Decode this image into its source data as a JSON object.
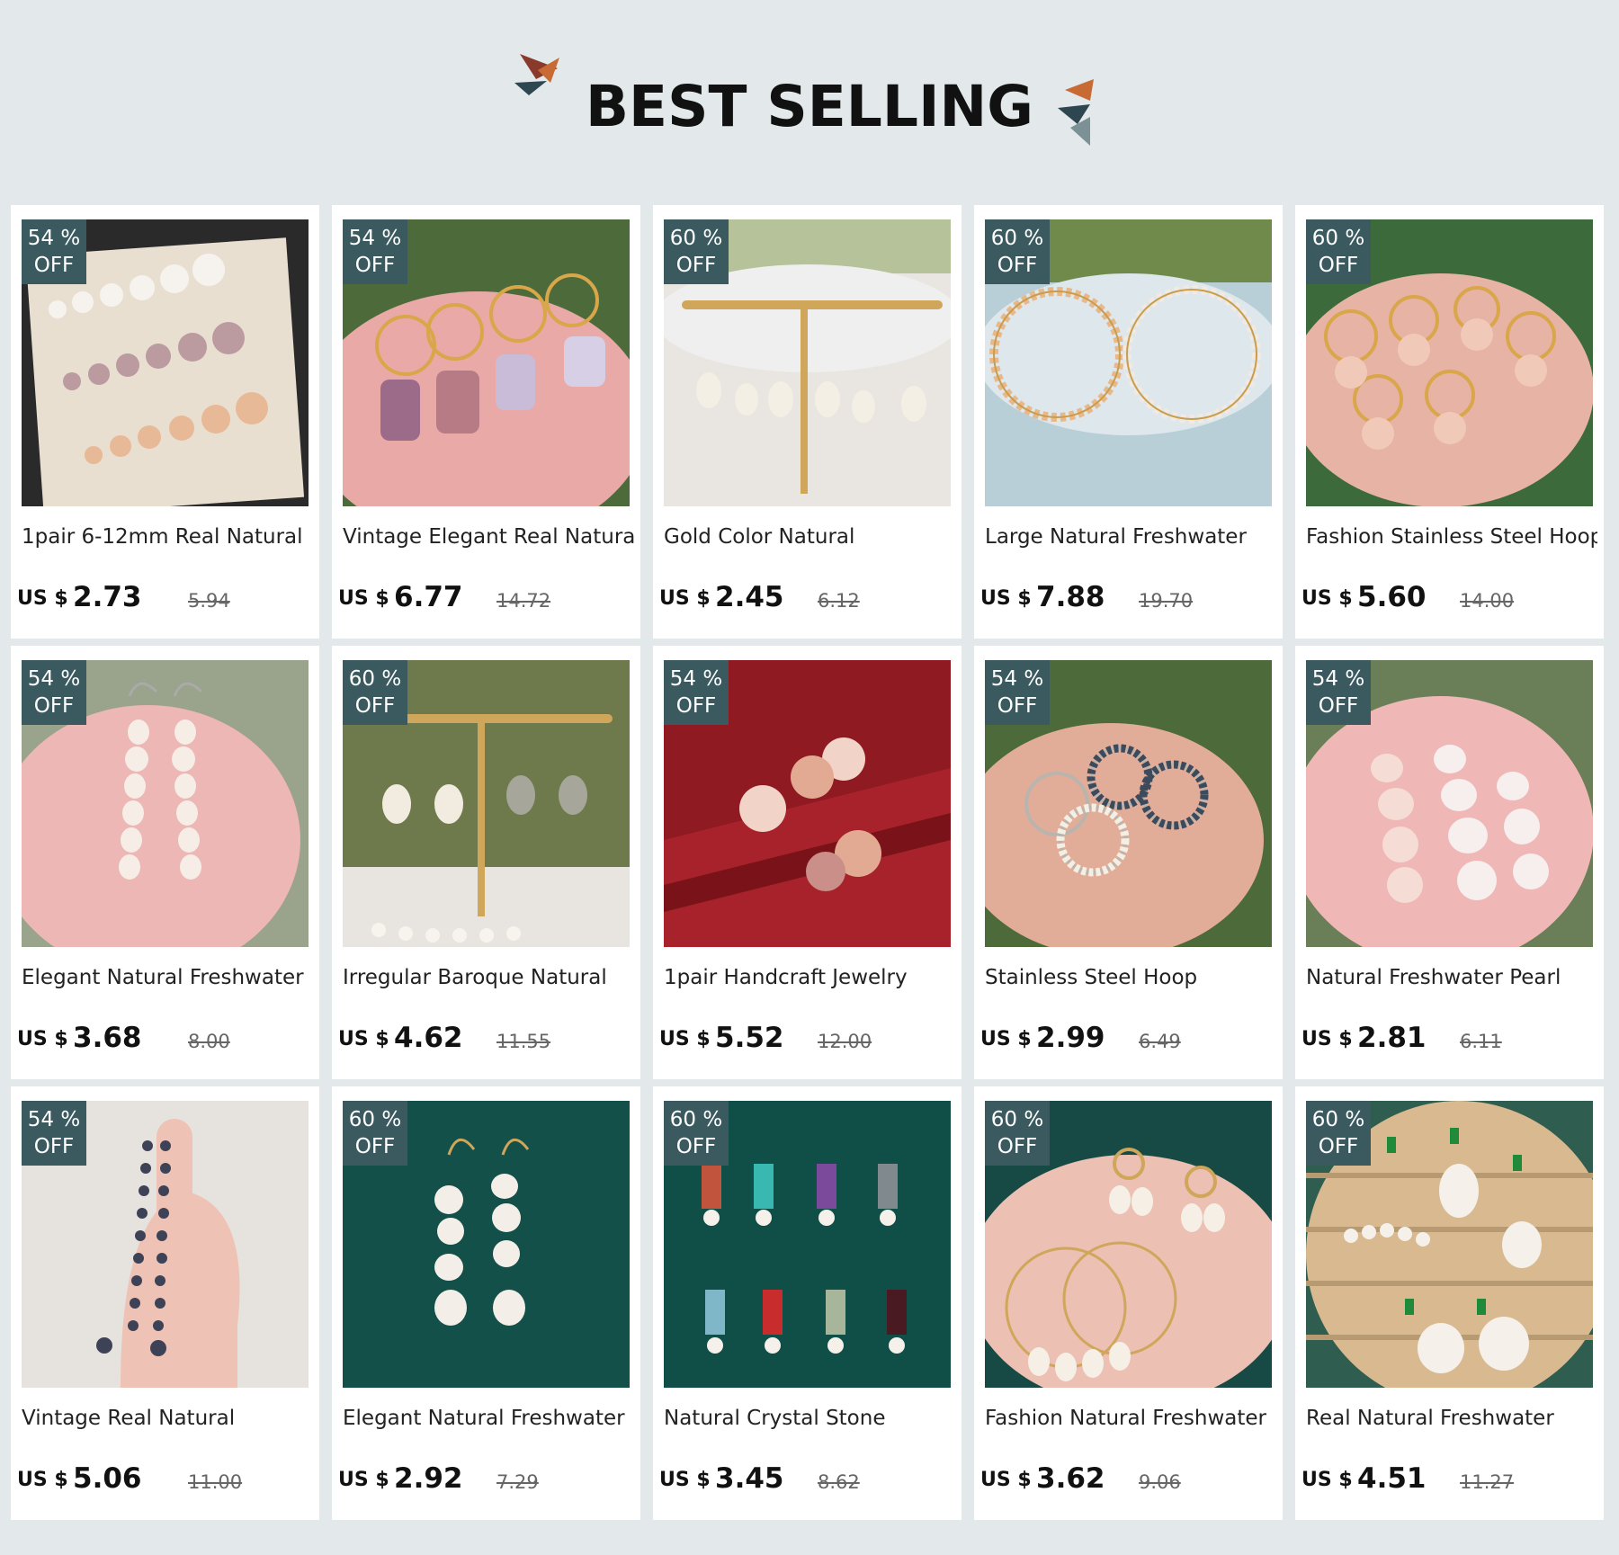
{
  "header": {
    "title": "BEST SELLING"
  },
  "colors": {
    "badge": "#3a5a60",
    "background": "#e3e9ea"
  },
  "products": [
    {
      "discount_pct": "54 %",
      "discount_word": "OFF",
      "name": "1pair 6-12mm Real Natural",
      "currency": "US $",
      "price": "2.73",
      "original_price": "5.94",
      "image": "pearl-strands-on-tray"
    },
    {
      "discount_pct": "54 %",
      "discount_word": "OFF",
      "name": "Vintage Elegant Real Natural",
      "currency": "US $",
      "price": "6.77",
      "original_price": "14.72",
      "image": "baroque-pearl-hoops-in-hand"
    },
    {
      "discount_pct": "60 %",
      "discount_word": "OFF",
      "name": "Gold Color Natural",
      "currency": "US $",
      "price": "2.45",
      "original_price": "6.12",
      "image": "pearl-huggies-on-stand"
    },
    {
      "discount_pct": "60 %",
      "discount_word": "OFF",
      "name": "Large Natural Freshwater",
      "currency": "US $",
      "price": "7.88",
      "original_price": "19.70",
      "image": "large-pearl-hoops"
    },
    {
      "discount_pct": "60 %",
      "discount_word": "OFF",
      "name": "Fashion Stainless Steel Hoop",
      "currency": "US $",
      "price": "5.60",
      "original_price": "14.00",
      "image": "pearl-cluster-hoops-in-hand"
    },
    {
      "discount_pct": "54 %",
      "discount_word": "OFF",
      "name": "Elegant Natural Freshwater",
      "currency": "US $",
      "price": "3.68",
      "original_price": "8.00",
      "image": "pearl-drop-earrings-in-hand"
    },
    {
      "discount_pct": "60 %",
      "discount_word": "OFF",
      "name": "Irregular Baroque Natural",
      "currency": "US $",
      "price": "4.62",
      "original_price": "11.55",
      "image": "cat-earrings-on-stand"
    },
    {
      "discount_pct": "54 %",
      "discount_word": "OFF",
      "name": "1pair Handcraft Jewelry",
      "currency": "US $",
      "price": "5.52",
      "original_price": "12.00",
      "image": "pearl-flower-earrings-on-red"
    },
    {
      "discount_pct": "54 %",
      "discount_word": "OFF",
      "name": "Stainless Steel Hoop",
      "currency": "US $",
      "price": "2.99",
      "original_price": "6.49",
      "image": "dark-pearl-hoops-in-hand"
    },
    {
      "discount_pct": "54 %",
      "discount_word": "OFF",
      "name": "Natural Freshwater Pearl",
      "currency": "US $",
      "price": "2.81",
      "original_price": "6.11",
      "image": "pink-pearl-drops-in-hand"
    },
    {
      "discount_pct": "54 %",
      "discount_word": "OFF",
      "name": "Vintage Real Natural",
      "currency": "US $",
      "price": "5.06",
      "original_price": "11.00",
      "image": "black-pearl-strands-in-hand"
    },
    {
      "discount_pct": "60 %",
      "discount_word": "OFF",
      "name": "Elegant Natural Freshwater",
      "currency": "US $",
      "price": "2.92",
      "original_price": "7.29",
      "image": "baroque-drops-on-green"
    },
    {
      "discount_pct": "60 %",
      "discount_word": "OFF",
      "name": "Natural Crystal Stone",
      "currency": "US $",
      "price": "3.45",
      "original_price": "8.62",
      "image": "crystal-stone-earrings-on-green"
    },
    {
      "discount_pct": "60 %",
      "discount_word": "OFF",
      "name": "Fashion Natural Freshwater",
      "currency": "US $",
      "price": "3.62",
      "original_price": "9.06",
      "image": "pearl-charm-hoops-in-hand"
    },
    {
      "discount_pct": "60 %",
      "discount_word": "OFF",
      "name": "Real Natural Freshwater",
      "currency": "US $",
      "price": "4.51",
      "original_price": "11.27",
      "image": "baroque-emerald-earrings-on-stand"
    }
  ]
}
